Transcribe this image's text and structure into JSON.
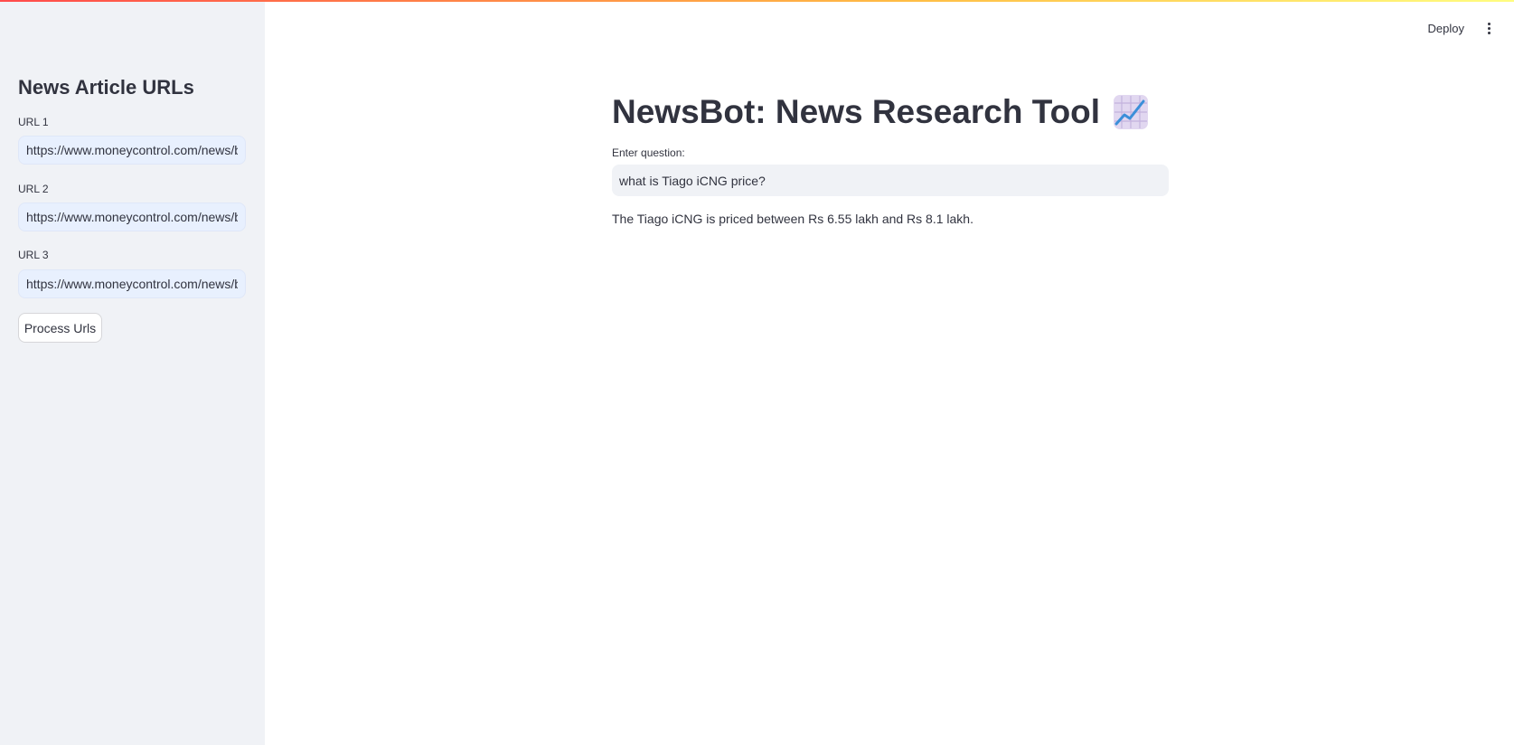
{
  "sidebar": {
    "title": "News Article URLs",
    "fields": [
      {
        "label": "URL 1",
        "value": "https://www.moneycontrol.com/news/b"
      },
      {
        "label": "URL 2",
        "value": "https://www.moneycontrol.com/news/b"
      },
      {
        "label": "URL 3",
        "value": "https://www.moneycontrol.com/news/b"
      }
    ],
    "process_label": "Process Urls"
  },
  "header": {
    "deploy_label": "Deploy",
    "menu_icon": "kebab-menu-icon"
  },
  "main": {
    "title": "NewsBot: News Research Tool",
    "title_icon": "chart-increasing-emoji",
    "question_label": "Enter question:",
    "question_value": "what is Tiago iCNG price?",
    "answer": "The Tiago iCNG is priced between Rs 6.55 lakh and Rs 8.1 lakh."
  },
  "colors": {
    "sidebar_bg": "#f0f2f6",
    "text": "#31333f",
    "input_autofill_bg": "#e8f0fe",
    "accent_gradient": [
      "#ff4b4b",
      "#ffbd45",
      "#fffd80"
    ]
  }
}
